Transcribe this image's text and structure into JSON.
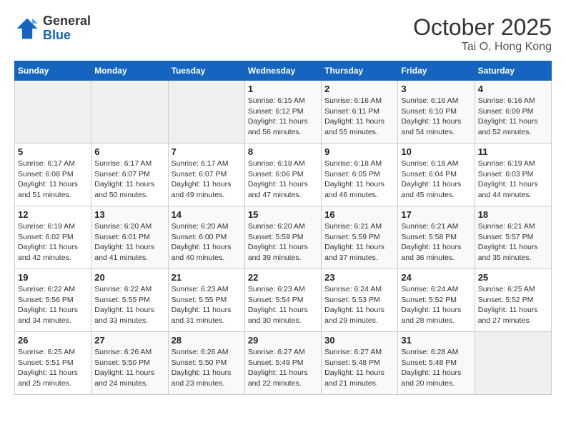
{
  "header": {
    "logo_line1": "General",
    "logo_line2": "Blue",
    "month_year": "October 2025",
    "location": "Tai O, Hong Kong"
  },
  "days_of_week": [
    "Sunday",
    "Monday",
    "Tuesday",
    "Wednesday",
    "Thursday",
    "Friday",
    "Saturday"
  ],
  "weeks": [
    [
      {
        "num": "",
        "detail": ""
      },
      {
        "num": "",
        "detail": ""
      },
      {
        "num": "",
        "detail": ""
      },
      {
        "num": "1",
        "detail": "Sunrise: 6:15 AM\nSunset: 6:12 PM\nDaylight: 11 hours\nand 56 minutes."
      },
      {
        "num": "2",
        "detail": "Sunrise: 6:16 AM\nSunset: 6:11 PM\nDaylight: 11 hours\nand 55 minutes."
      },
      {
        "num": "3",
        "detail": "Sunrise: 6:16 AM\nSunset: 6:10 PM\nDaylight: 11 hours\nand 54 minutes."
      },
      {
        "num": "4",
        "detail": "Sunrise: 6:16 AM\nSunset: 6:09 PM\nDaylight: 11 hours\nand 52 minutes."
      }
    ],
    [
      {
        "num": "5",
        "detail": "Sunrise: 6:17 AM\nSunset: 6:08 PM\nDaylight: 11 hours\nand 51 minutes."
      },
      {
        "num": "6",
        "detail": "Sunrise: 6:17 AM\nSunset: 6:07 PM\nDaylight: 11 hours\nand 50 minutes."
      },
      {
        "num": "7",
        "detail": "Sunrise: 6:17 AM\nSunset: 6:07 PM\nDaylight: 11 hours\nand 49 minutes."
      },
      {
        "num": "8",
        "detail": "Sunrise: 6:18 AM\nSunset: 6:06 PM\nDaylight: 11 hours\nand 47 minutes."
      },
      {
        "num": "9",
        "detail": "Sunrise: 6:18 AM\nSunset: 6:05 PM\nDaylight: 11 hours\nand 46 minutes."
      },
      {
        "num": "10",
        "detail": "Sunrise: 6:18 AM\nSunset: 6:04 PM\nDaylight: 11 hours\nand 45 minutes."
      },
      {
        "num": "11",
        "detail": "Sunrise: 6:19 AM\nSunset: 6:03 PM\nDaylight: 11 hours\nand 44 minutes."
      }
    ],
    [
      {
        "num": "12",
        "detail": "Sunrise: 6:19 AM\nSunset: 6:02 PM\nDaylight: 11 hours\nand 42 minutes."
      },
      {
        "num": "13",
        "detail": "Sunrise: 6:20 AM\nSunset: 6:01 PM\nDaylight: 11 hours\nand 41 minutes."
      },
      {
        "num": "14",
        "detail": "Sunrise: 6:20 AM\nSunset: 6:00 PM\nDaylight: 11 hours\nand 40 minutes."
      },
      {
        "num": "15",
        "detail": "Sunrise: 6:20 AM\nSunset: 5:59 PM\nDaylight: 11 hours\nand 39 minutes."
      },
      {
        "num": "16",
        "detail": "Sunrise: 6:21 AM\nSunset: 5:59 PM\nDaylight: 11 hours\nand 37 minutes."
      },
      {
        "num": "17",
        "detail": "Sunrise: 6:21 AM\nSunset: 5:58 PM\nDaylight: 11 hours\nand 36 minutes."
      },
      {
        "num": "18",
        "detail": "Sunrise: 6:21 AM\nSunset: 5:57 PM\nDaylight: 11 hours\nand 35 minutes."
      }
    ],
    [
      {
        "num": "19",
        "detail": "Sunrise: 6:22 AM\nSunset: 5:56 PM\nDaylight: 11 hours\nand 34 minutes."
      },
      {
        "num": "20",
        "detail": "Sunrise: 6:22 AM\nSunset: 5:55 PM\nDaylight: 11 hours\nand 33 minutes."
      },
      {
        "num": "21",
        "detail": "Sunrise: 6:23 AM\nSunset: 5:55 PM\nDaylight: 11 hours\nand 31 minutes."
      },
      {
        "num": "22",
        "detail": "Sunrise: 6:23 AM\nSunset: 5:54 PM\nDaylight: 11 hours\nand 30 minutes."
      },
      {
        "num": "23",
        "detail": "Sunrise: 6:24 AM\nSunset: 5:53 PM\nDaylight: 11 hours\nand 29 minutes."
      },
      {
        "num": "24",
        "detail": "Sunrise: 6:24 AM\nSunset: 5:52 PM\nDaylight: 11 hours\nand 28 minutes."
      },
      {
        "num": "25",
        "detail": "Sunrise: 6:25 AM\nSunset: 5:52 PM\nDaylight: 11 hours\nand 27 minutes."
      }
    ],
    [
      {
        "num": "26",
        "detail": "Sunrise: 6:25 AM\nSunset: 5:51 PM\nDaylight: 11 hours\nand 25 minutes."
      },
      {
        "num": "27",
        "detail": "Sunrise: 6:26 AM\nSunset: 5:50 PM\nDaylight: 11 hours\nand 24 minutes."
      },
      {
        "num": "28",
        "detail": "Sunrise: 6:26 AM\nSunset: 5:50 PM\nDaylight: 11 hours\nand 23 minutes."
      },
      {
        "num": "29",
        "detail": "Sunrise: 6:27 AM\nSunset: 5:49 PM\nDaylight: 11 hours\nand 22 minutes."
      },
      {
        "num": "30",
        "detail": "Sunrise: 6:27 AM\nSunset: 5:48 PM\nDaylight: 11 hours\nand 21 minutes."
      },
      {
        "num": "31",
        "detail": "Sunrise: 6:28 AM\nSunset: 5:48 PM\nDaylight: 11 hours\nand 20 minutes."
      },
      {
        "num": "",
        "detail": ""
      }
    ]
  ]
}
